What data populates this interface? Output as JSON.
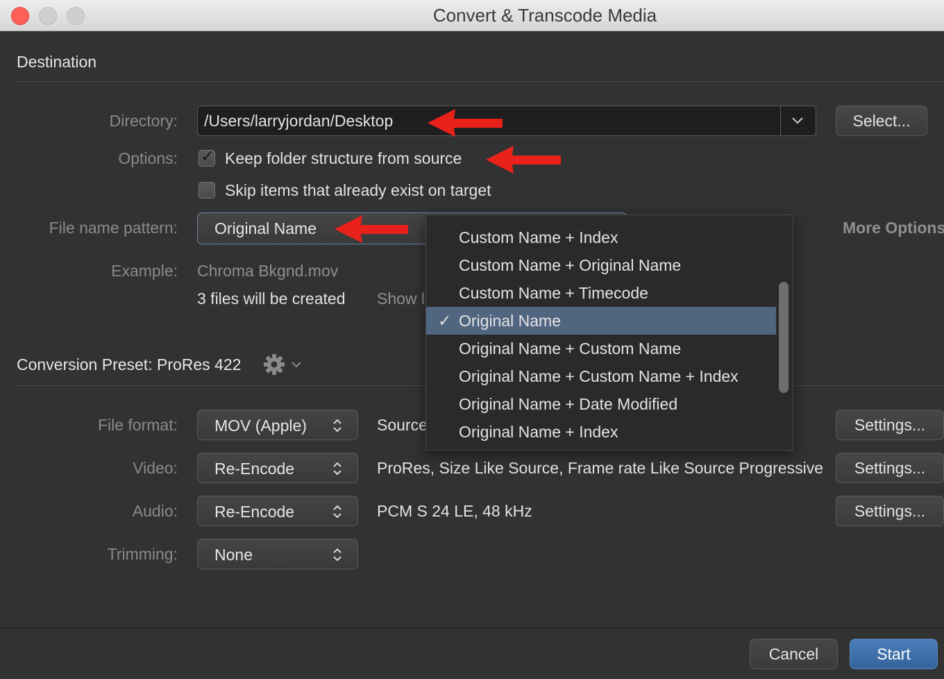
{
  "window": {
    "title": "Convert & Transcode Media"
  },
  "destination": {
    "heading": "Destination",
    "directory_label": "Directory:",
    "directory_value": "/Users/larryjordan/Desktop",
    "select_button": "Select...",
    "options_label": "Options:",
    "keep_folder_label": "Keep folder structure from source",
    "keep_folder_checked": true,
    "skip_items_label": "Skip items that already exist on target",
    "skip_items_checked": false,
    "file_name_pattern_label": "File name pattern:",
    "file_name_pattern_value": "Original Name",
    "more_options_label": "More Options",
    "example_label": "Example:",
    "example_value": "Chroma Bkgnd.mov",
    "files_created": "3 files will be created",
    "show_label": "Show l"
  },
  "pattern_menu": {
    "items": [
      "Custom Name + Index",
      "Custom Name + Original Name",
      "Custom Name + Timecode",
      "Original Name",
      "Original Name + Custom Name",
      "Original Name + Custom Name + Index",
      "Original Name + Date Modified",
      "Original Name + Index"
    ],
    "selected": "Original Name",
    "check_glyph": "✓"
  },
  "conversion": {
    "heading": "Conversion Preset: ProRes 422",
    "file_format_label": "File format:",
    "file_format_value": "MOV (Apple)",
    "file_format_desc": "Source",
    "video_label": "Video:",
    "video_value": "Re-Encode",
    "video_desc": "ProRes, Size Like Source, Frame rate Like Source Progressive",
    "audio_label": "Audio:",
    "audio_value": "Re-Encode",
    "audio_desc": "PCM S 24 LE, 48 kHz",
    "trimming_label": "Trimming:",
    "trimming_value": "None",
    "settings_button": "Settings..."
  },
  "footer": {
    "cancel": "Cancel",
    "start": "Start"
  },
  "colors": {
    "annotation_arrow": "#e8211b",
    "selected_item": "#506580",
    "start_button": "#3f6fa8"
  },
  "icons": [
    "gear-icon",
    "chevron-down-icon",
    "updown-icon",
    "checkmark-icon"
  ]
}
